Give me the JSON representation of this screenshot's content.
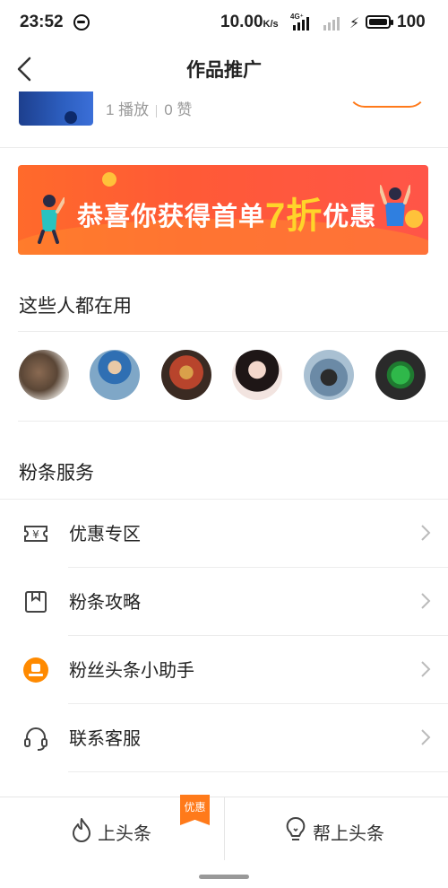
{
  "status_bar": {
    "time": "23:52",
    "speed_value": "10.00",
    "speed_unit": "K/s",
    "network": "4G⁺",
    "battery": "100"
  },
  "header": {
    "title": "作品推广"
  },
  "previous_item": {
    "plays": "1 播放",
    "likes": "0 赞"
  },
  "banner": {
    "text_before": "恭喜你获得首单",
    "text_number": "7折",
    "text_after": "优惠"
  },
  "users_section": {
    "title": "这些人都在用",
    "avatars": 6
  },
  "service_section": {
    "title": "粉条服务",
    "items": [
      {
        "label": "优惠专区",
        "icon": "coupon-icon"
      },
      {
        "label": "粉条攻略",
        "icon": "bookmark-icon"
      },
      {
        "label": "粉丝头条小助手",
        "icon": "fans-headline-logo-icon"
      },
      {
        "label": "联系客服",
        "icon": "headset-icon"
      }
    ]
  },
  "bottom_bar": {
    "left_label": "上头条",
    "left_icon": "flame-icon",
    "tag": "优惠",
    "right_label": "帮上头条",
    "right_icon": "lightbulb-icon"
  },
  "colors": {
    "accent": "#ff7a1a",
    "banner": "#ff5a36",
    "highlight": "#ffd42a"
  }
}
